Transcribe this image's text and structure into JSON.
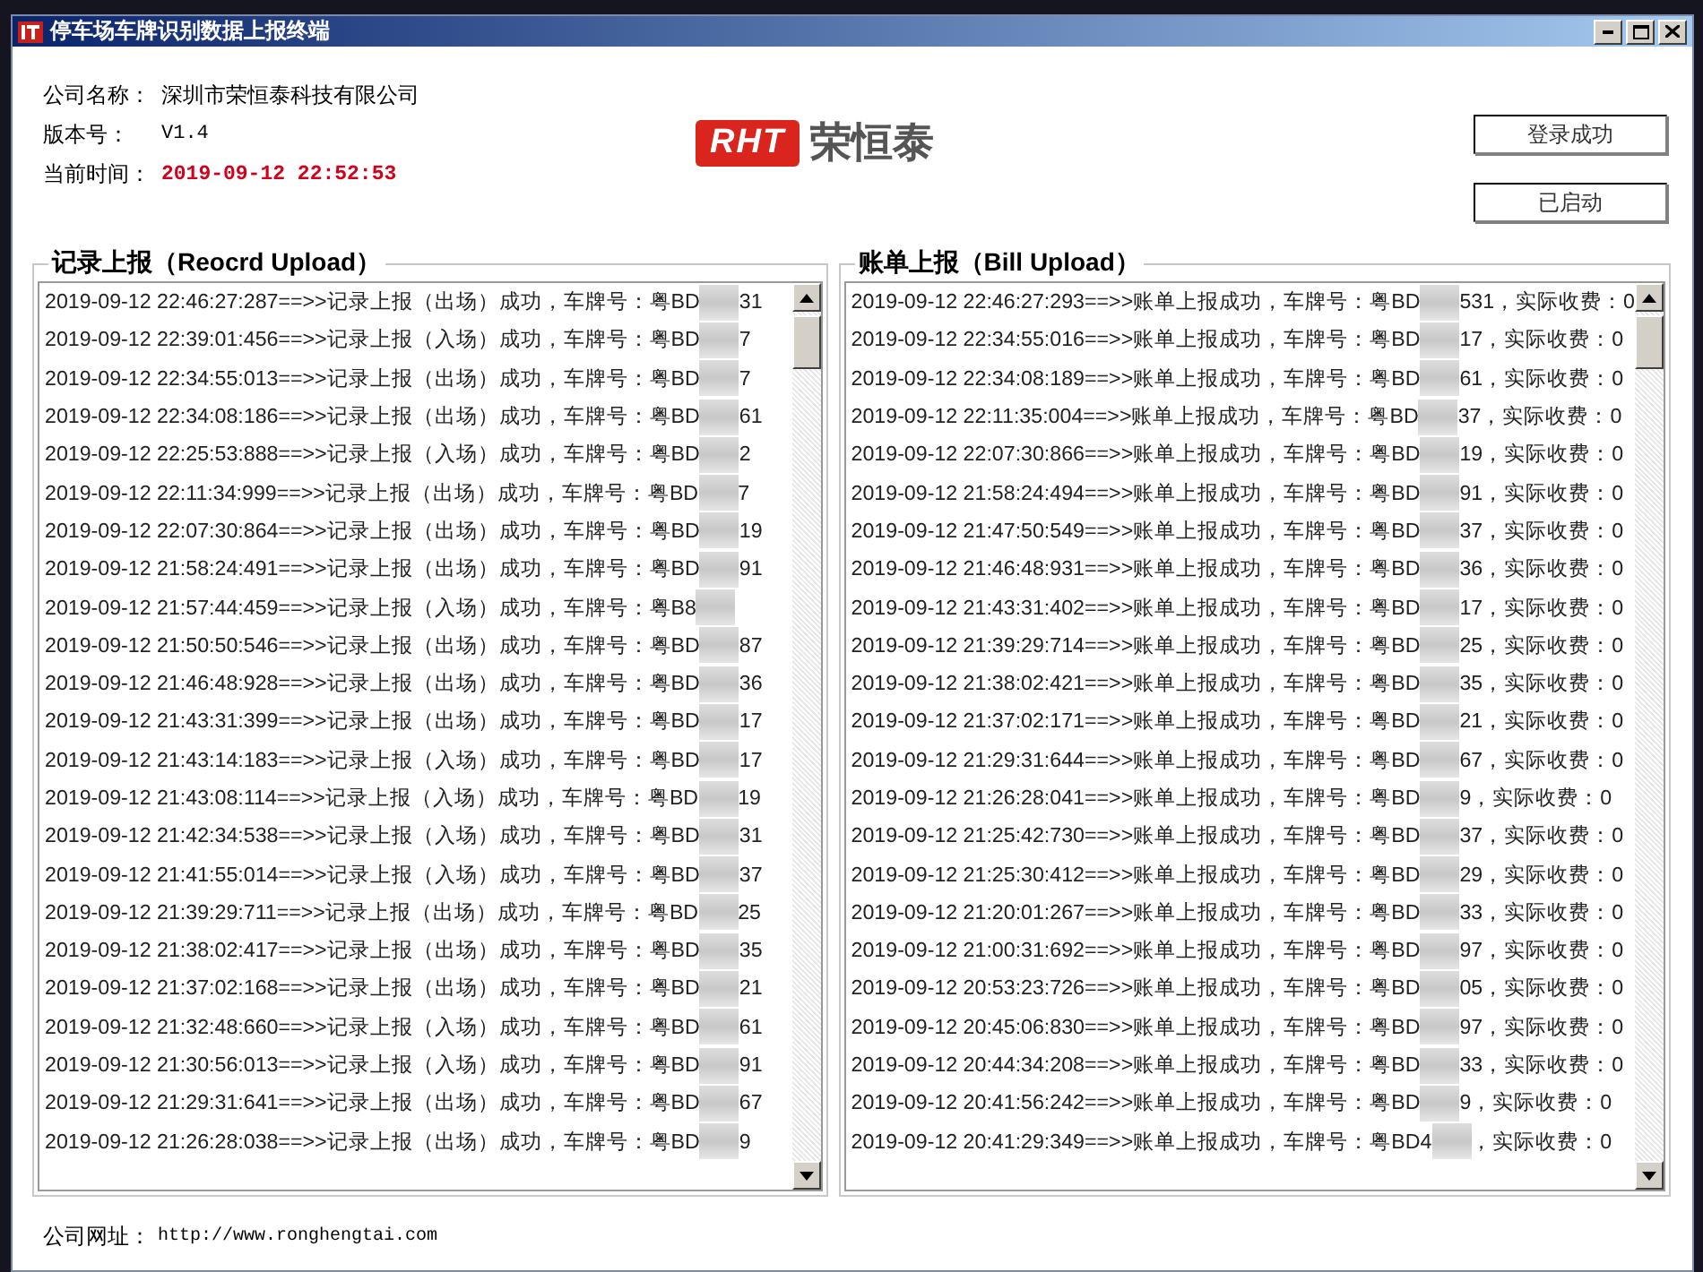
{
  "window": {
    "title": "停车场车牌识别数据上报终端"
  },
  "info": [
    {
      "label": "公司名称：",
      "value": "深圳市荣恒泰科技有限公司",
      "kind": "plain"
    },
    {
      "label": "版本号：",
      "value": "V1.4",
      "kind": "mono"
    },
    {
      "label": "当前时间：",
      "value": "2019-09-12 22:52:53",
      "kind": "time"
    }
  ],
  "logo": {
    "mark": "RHT",
    "name": "荣恒泰"
  },
  "buttons": [
    "登录成功",
    "已启动"
  ],
  "record_upload": {
    "title": "记录上报（Reocrd Upload）",
    "rows": [
      {
        "before": "2019-09-12 22:46:27:287==>>记录上报（出场）成功，车牌号：粤BD",
        "after": "31"
      },
      {
        "before": "2019-09-12 22:39:01:456==>>记录上报（入场）成功，车牌号：粤BD",
        "after": "7"
      },
      {
        "before": "2019-09-12 22:34:55:013==>>记录上报（出场）成功，车牌号：粤BD",
        "after": "7"
      },
      {
        "before": "2019-09-12 22:34:08:186==>>记录上报（出场）成功，车牌号：粤BD",
        "after": "61"
      },
      {
        "before": "2019-09-12 22:25:53:888==>>记录上报（入场）成功，车牌号：粤BD",
        "after": "2"
      },
      {
        "before": "2019-09-12 22:11:34:999==>>记录上报（出场）成功，车牌号：粤BD",
        "after": "7"
      },
      {
        "before": "2019-09-12 22:07:30:864==>>记录上报（出场）成功，车牌号：粤BD",
        "after": "19"
      },
      {
        "before": "2019-09-12 21:58:24:491==>>记录上报（出场）成功，车牌号：粤BD",
        "after": "91"
      },
      {
        "before": "2019-09-12 21:57:44:459==>>记录上报（入场）成功，车牌号：粤B8",
        "after": ""
      },
      {
        "before": "2019-09-12 21:50:50:546==>>记录上报（出场）成功，车牌号：粤BD",
        "after": "87"
      },
      {
        "before": "2019-09-12 21:46:48:928==>>记录上报（出场）成功，车牌号：粤BD",
        "after": "36"
      },
      {
        "before": "2019-09-12 21:43:31:399==>>记录上报（出场）成功，车牌号：粤BD",
        "after": "17"
      },
      {
        "before": "2019-09-12 21:43:14:183==>>记录上报（入场）成功，车牌号：粤BD",
        "after": "17"
      },
      {
        "before": "2019-09-12 21:43:08:114==>>记录上报（入场）成功，车牌号：粤BD",
        "after": "19"
      },
      {
        "before": "2019-09-12 21:42:34:538==>>记录上报（入场）成功，车牌号：粤BD",
        "after": "31"
      },
      {
        "before": "2019-09-12 21:41:55:014==>>记录上报（入场）成功，车牌号：粤BD",
        "after": "37"
      },
      {
        "before": "2019-09-12 21:39:29:711==>>记录上报（出场）成功，车牌号：粤BD",
        "after": "25"
      },
      {
        "before": "2019-09-12 21:38:02:417==>>记录上报（出场）成功，车牌号：粤BD",
        "after": "35"
      },
      {
        "before": "2019-09-12 21:37:02:168==>>记录上报（出场）成功，车牌号：粤BD",
        "after": "21"
      },
      {
        "before": "2019-09-12 21:32:48:660==>>记录上报（入场）成功，车牌号：粤BD",
        "after": "61"
      },
      {
        "before": "2019-09-12 21:30:56:013==>>记录上报（入场）成功，车牌号：粤BD",
        "after": "91"
      },
      {
        "before": "2019-09-12 21:29:31:641==>>记录上报（出场）成功，车牌号：粤BD",
        "after": "67"
      },
      {
        "before": "2019-09-12 21:26:28:038==>>记录上报（出场）成功，车牌号：粤BD",
        "after": "9"
      }
    ]
  },
  "bill_upload": {
    "title": "账单上报（Bill Upload）",
    "rows": [
      {
        "before": "2019-09-12 22:46:27:293==>>账单上报成功，车牌号：粤BD",
        "after": "531，实际收费：0"
      },
      {
        "before": "2019-09-12 22:34:55:016==>>账单上报成功，车牌号：粤BD",
        "after": "17，实际收费：0"
      },
      {
        "before": "2019-09-12 22:34:08:189==>>账单上报成功，车牌号：粤BD",
        "after": "61，实际收费：0"
      },
      {
        "before": "2019-09-12 22:11:35:004==>>账单上报成功，车牌号：粤BD",
        "after": "37，实际收费：0"
      },
      {
        "before": "2019-09-12 22:07:30:866==>>账单上报成功，车牌号：粤BD",
        "after": "19，实际收费：0"
      },
      {
        "before": "2019-09-12 21:58:24:494==>>账单上报成功，车牌号：粤BD",
        "after": "91，实际收费：0"
      },
      {
        "before": "2019-09-12 21:47:50:549==>>账单上报成功，车牌号：粤BD",
        "after": "37，实际收费：0"
      },
      {
        "before": "2019-09-12 21:46:48:931==>>账单上报成功，车牌号：粤BD",
        "after": "36，实际收费：0"
      },
      {
        "before": "2019-09-12 21:43:31:402==>>账单上报成功，车牌号：粤BD",
        "after": "17，实际收费：0"
      },
      {
        "before": "2019-09-12 21:39:29:714==>>账单上报成功，车牌号：粤BD",
        "after": "25，实际收费：0"
      },
      {
        "before": "2019-09-12 21:38:02:421==>>账单上报成功，车牌号：粤BD",
        "after": "35，实际收费：0"
      },
      {
        "before": "2019-09-12 21:37:02:171==>>账单上报成功，车牌号：粤BD",
        "after": "21，实际收费：0"
      },
      {
        "before": "2019-09-12 21:29:31:644==>>账单上报成功，车牌号：粤BD",
        "after": "67，实际收费：0"
      },
      {
        "before": "2019-09-12 21:26:28:041==>>账单上报成功，车牌号：粤BD",
        "after": "9，实际收费：0"
      },
      {
        "before": "2019-09-12 21:25:42:730==>>账单上报成功，车牌号：粤BD",
        "after": "37，实际收费：0"
      },
      {
        "before": "2019-09-12 21:25:30:412==>>账单上报成功，车牌号：粤BD",
        "after": "29，实际收费：0"
      },
      {
        "before": "2019-09-12 21:20:01:267==>>账单上报成功，车牌号：粤BD",
        "after": "33，实际收费：0"
      },
      {
        "before": "2019-09-12 21:00:31:692==>>账单上报成功，车牌号：粤BD",
        "after": "97，实际收费：0"
      },
      {
        "before": "2019-09-12 20:53:23:726==>>账单上报成功，车牌号：粤BD",
        "after": "05，实际收费：0"
      },
      {
        "before": "2019-09-12 20:45:06:830==>>账单上报成功，车牌号：粤BD",
        "after": "97，实际收费：0"
      },
      {
        "before": "2019-09-12 20:44:34:208==>>账单上报成功，车牌号：粤BD",
        "after": "33，实际收费：0"
      },
      {
        "before": "2019-09-12 20:41:56:242==>>账单上报成功，车牌号：粤BD",
        "after": "9，实际收费：0"
      },
      {
        "before": "2019-09-12 20:41:29:349==>>账单上报成功，车牌号：粤BD4",
        "after": "，实际收费：0"
      }
    ]
  },
  "footer": {
    "label": "公司网址：",
    "url": "http://www.ronghengtai.com"
  }
}
